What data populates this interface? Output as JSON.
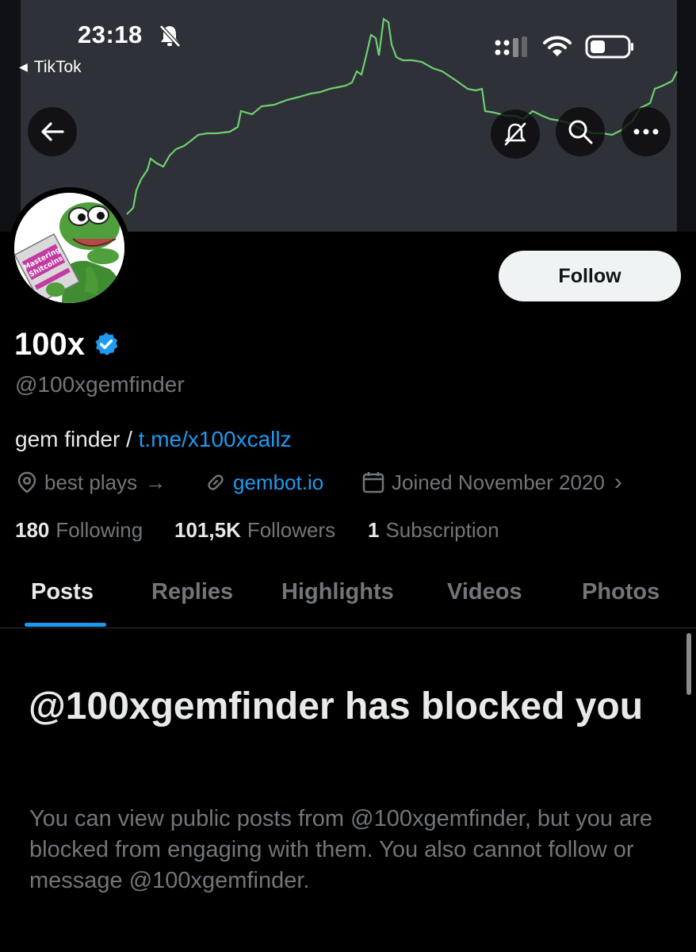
{
  "status_bar": {
    "time": "23:18",
    "back_app": "TikTok"
  },
  "header": {
    "icons": [
      "back-arrow-icon",
      "no-notifications-icon",
      "search-icon",
      "more-icon"
    ]
  },
  "profile": {
    "follow_label": "Follow",
    "display_name": "100x",
    "verified": true,
    "handle": "@100xgemfinder",
    "bio_text": "gem finder / ",
    "bio_link": "t.me/x100xcallz",
    "location": "best plays",
    "location_arrow": "→",
    "website": "gembot.io",
    "joined": "Joined November 2020",
    "joined_chevron": "›",
    "stats": {
      "following_count": "180",
      "following_label": "Following",
      "followers_count": "101,5K",
      "followers_label": "Followers",
      "subscription_count": "1",
      "subscription_label": "Subscription"
    },
    "avatar_book_text": "Mastering Shitcoins"
  },
  "tabs": [
    {
      "label": "Posts",
      "active": true
    },
    {
      "label": "Replies",
      "active": false
    },
    {
      "label": "Highlights",
      "active": false
    },
    {
      "label": "Videos",
      "active": false
    },
    {
      "label": "Photos",
      "active": false
    }
  ],
  "blocked": {
    "title": "@100xgemfinder has blocked you",
    "body": "You can view public posts from @100xgemfinder, but you are blocked from engaging with them. You also cannot follow or message @100xgemfinder."
  },
  "colors": {
    "accent": "#1d9bf0",
    "chart_line": "#6fcf6f",
    "banner_bg": "#2e3138",
    "muted_text": "#71767b"
  }
}
